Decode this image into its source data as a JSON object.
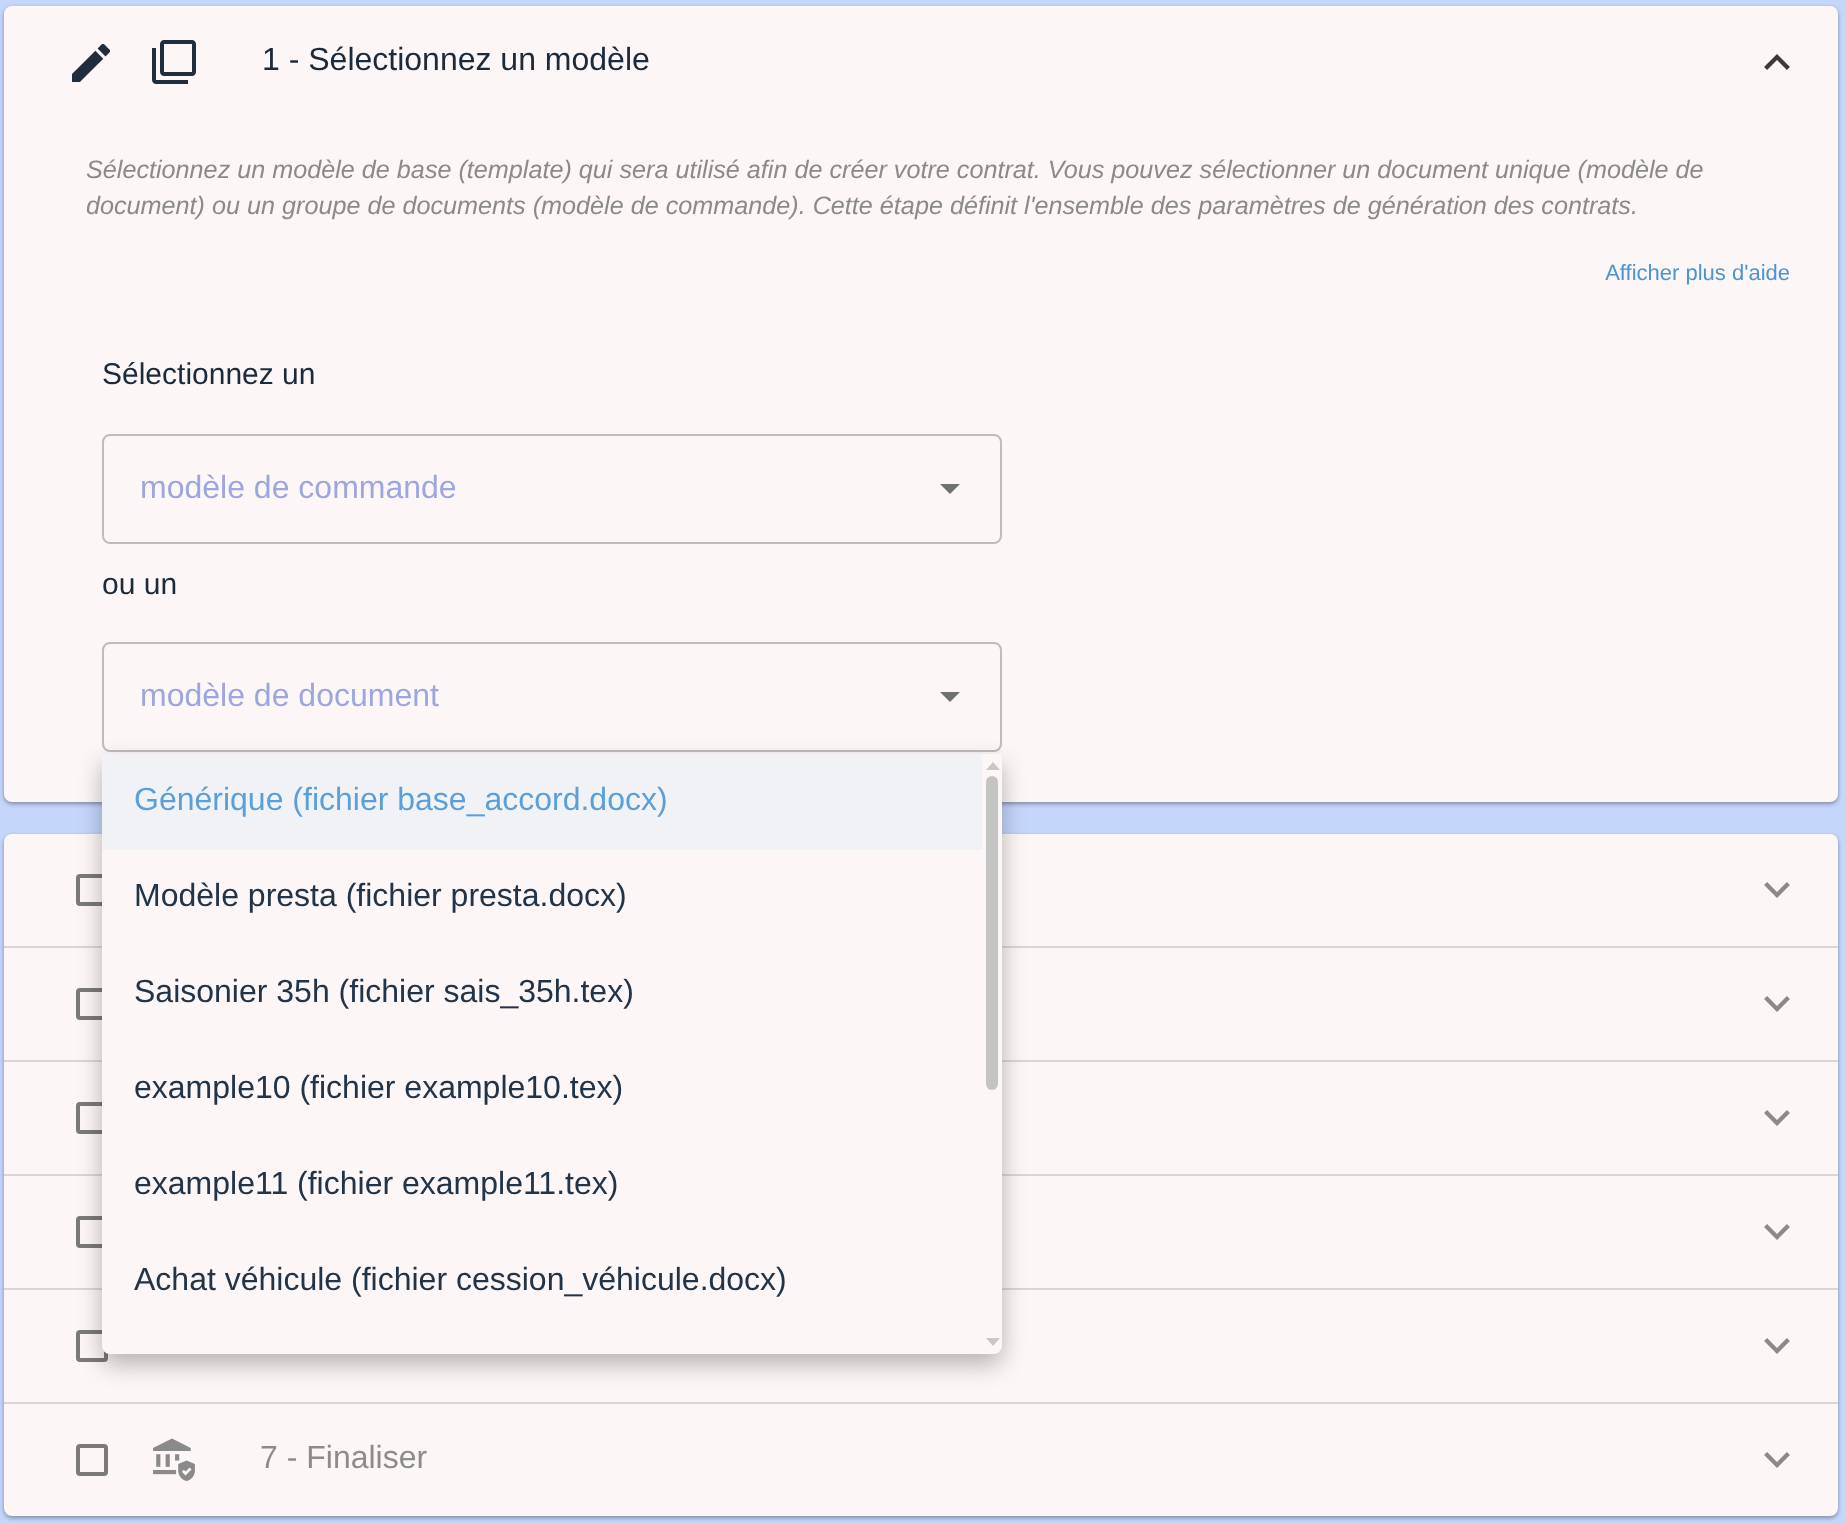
{
  "steps": [
    {
      "kind": "current",
      "title": "1 - Sélectionnez un modèle",
      "expanded": true,
      "description": "Sélectionnez un modèle de base (template) qui sera utilisé afin de créer votre contrat. Vous pouvez sélectionner un document unique (modèle de document) ou un groupe de documents (modèle de commande). Cette étape définit l'ensemble des paramètres de génération des contrats.",
      "help_link": "Afficher plus d'aide",
      "form": {
        "prompt": "Sélectionnez un",
        "order_select": {
          "placeholder": "modèle de commande"
        },
        "alternative_label": "ou un",
        "document_select": {
          "placeholder": "modèle de document",
          "open": true,
          "options": [
            {
              "label": "Générique (fichier base_accord.docx)",
              "selected": true
            },
            {
              "label": "Modèle presta (fichier presta.docx)",
              "selected": false
            },
            {
              "label": "Saisonier 35h (fichier sais_35h.tex)",
              "selected": false
            },
            {
              "label": "example10 (fichier example10.tex)",
              "selected": false
            },
            {
              "label": "example11 (fichier example11.tex)",
              "selected": false
            },
            {
              "label": "Achat véhicule (fichier cession_véhicule.docx)",
              "selected": false
            }
          ]
        }
      }
    },
    {
      "kind": "pending",
      "checked": false,
      "expanded": false
    },
    {
      "kind": "pending",
      "checked": false,
      "expanded": false
    },
    {
      "kind": "pending",
      "checked": false,
      "expanded": false
    },
    {
      "kind": "pending",
      "checked": false,
      "expanded": false
    },
    {
      "kind": "pending",
      "checked": false,
      "expanded": false
    },
    {
      "kind": "finalize",
      "title": "7 - Finaliser",
      "checked": false,
      "expanded": false
    }
  ]
}
